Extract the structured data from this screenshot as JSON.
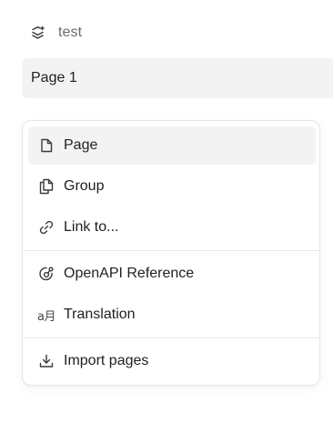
{
  "space": {
    "label": "test",
    "icon": "layers-sparkle-icon"
  },
  "current_page": {
    "label": "Page 1"
  },
  "menu": {
    "items": [
      {
        "label": "Page",
        "icon": "page-icon",
        "active": true
      },
      {
        "label": "Group",
        "icon": "group-icon",
        "active": false
      },
      {
        "label": "Link to...",
        "icon": "link-icon",
        "active": false
      },
      {
        "label": "OpenAPI Reference",
        "icon": "openapi-icon",
        "active": false
      },
      {
        "label": "Translation",
        "icon": "translation-icon",
        "glyph": "a月",
        "active": false
      },
      {
        "label": "Import pages",
        "icon": "import-icon",
        "active": false
      }
    ]
  },
  "colors": {
    "highlight": "#f3f3f3",
    "border": "#e6e6e6",
    "text": "#1f1f1f",
    "muted": "#6b6b6b"
  }
}
